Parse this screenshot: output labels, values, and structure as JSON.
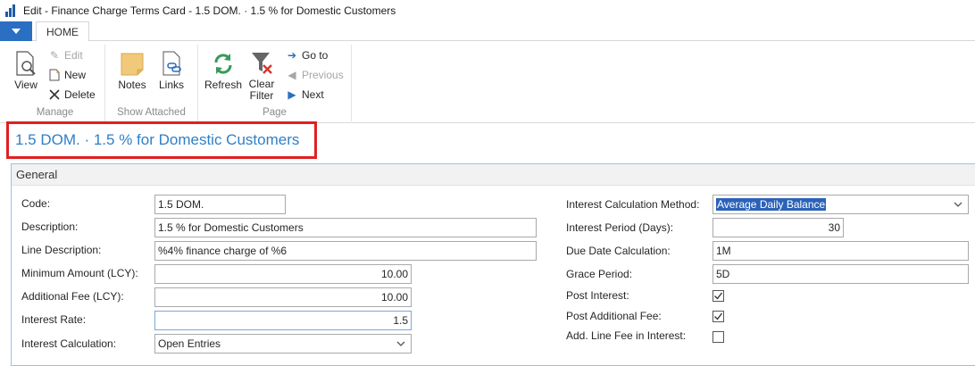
{
  "window": {
    "title": "Edit - Finance Charge Terms Card - 1.5 DOM. · 1.5 % for Domestic Customers"
  },
  "tabs": {
    "home": "HOME"
  },
  "ribbon": {
    "manage": {
      "label": "Manage",
      "view": "View",
      "edit": "Edit",
      "new": "New",
      "delete": "Delete"
    },
    "show_attached": {
      "label": "Show Attached",
      "notes": "Notes",
      "links": "Links"
    },
    "page": {
      "label": "Page",
      "refresh": "Refresh",
      "clear_filter_line1": "Clear",
      "clear_filter_line2": "Filter",
      "goto": "Go to",
      "previous": "Previous",
      "next": "Next"
    }
  },
  "heading": "1.5 DOM. · 1.5 % for Domestic Customers",
  "general": {
    "title": "General",
    "left": {
      "code": {
        "label": "Code:",
        "value": "1.5 DOM."
      },
      "description": {
        "label": "Description:",
        "value": "1.5 % for Domestic Customers"
      },
      "line_description": {
        "label": "Line Description:",
        "value": "%4% finance charge of %6"
      },
      "minimum_amount": {
        "label": "Minimum Amount (LCY):",
        "value": "10.00"
      },
      "additional_fee": {
        "label": "Additional Fee (LCY):",
        "value": "10.00"
      },
      "interest_rate": {
        "label": "Interest Rate:",
        "value": "1.5"
      },
      "interest_calculation": {
        "label": "Interest Calculation:",
        "value": "Open Entries"
      }
    },
    "right": {
      "interest_calc_method": {
        "label": "Interest Calculation Method:",
        "value": "Average Daily Balance"
      },
      "interest_period": {
        "label": "Interest Period (Days):",
        "value": "30"
      },
      "due_date_calc": {
        "label": "Due Date Calculation:",
        "value": "1M"
      },
      "grace_period": {
        "label": "Grace Period:",
        "value": "5D"
      },
      "post_interest": {
        "label": "Post Interest:",
        "checked": true
      },
      "post_additional_fee": {
        "label": "Post Additional Fee:",
        "checked": true
      },
      "add_line_fee": {
        "label": "Add. Line Fee in Interest:",
        "checked": false
      }
    }
  },
  "colors": {
    "accent": "#2b6fc2",
    "heading": "#2f7fc6",
    "highlight_border": "#e0201f"
  }
}
